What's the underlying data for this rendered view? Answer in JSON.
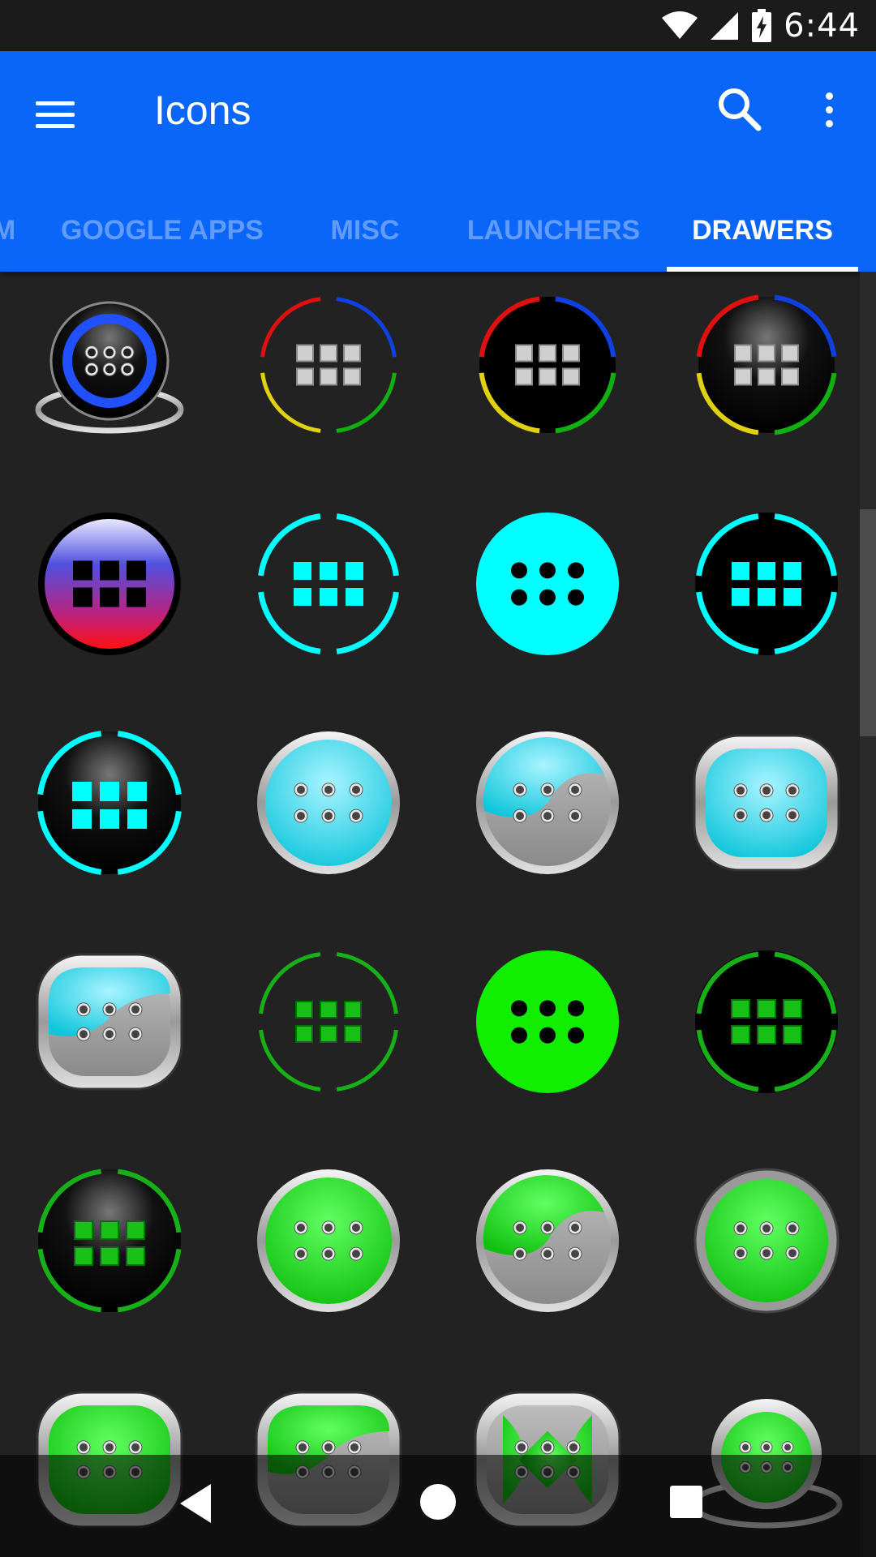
{
  "status_bar": {
    "time": "6:44",
    "icons": [
      "wifi-icon",
      "cell-signal-icon",
      "battery-charging-icon"
    ]
  },
  "app_bar": {
    "title": "Icons",
    "menu_icon": "hamburger-menu-icon",
    "search_icon": "search-icon",
    "more_icon": "more-vert-icon",
    "color": "#0a66f8"
  },
  "tabs": [
    {
      "label": "M",
      "active": false
    },
    {
      "label": "GOOGLE APPS",
      "active": false
    },
    {
      "label": "MISC",
      "active": false
    },
    {
      "label": "LAUNCHERS",
      "active": false
    },
    {
      "label": "DRAWERS",
      "active": true
    }
  ],
  "icon_grid": {
    "columns": 4,
    "rows": [
      [
        "chrome-blue-dome",
        "ring-rgby-silver-grid",
        "ring-rgby-black-grid",
        "ring-rgby-glossy-grid"
      ],
      [
        "gradient-blue-red-grid",
        "ring-cyan-outline-grid",
        "solid-cyan-dots",
        "ring-cyan-black-grid"
      ],
      [
        "glossy-black-cyan-grid",
        "glossy-cyan-dots",
        "cyan-silver-wave",
        "chrome-cyan-frame"
      ],
      [
        "chrome-cyan-silver-wave",
        "ring-green-outline-grid",
        "solid-green-dots",
        "ring-green-black-grid"
      ],
      [
        "glossy-black-green-grid",
        "glossy-green-dots",
        "green-silver-wave",
        "gear-green-dots"
      ],
      [
        "chrome-green-frame",
        "chrome-green-silver-wave",
        "chrome-green-swirl",
        "chrome-green-dome"
      ]
    ]
  },
  "nav_bar": {
    "icons": [
      "back-icon",
      "home-icon",
      "recents-icon"
    ]
  },
  "colors": {
    "background": "#222222",
    "cyan": "#00ffff",
    "green": "#11ee00",
    "accent_blue": "#0a66f8"
  }
}
